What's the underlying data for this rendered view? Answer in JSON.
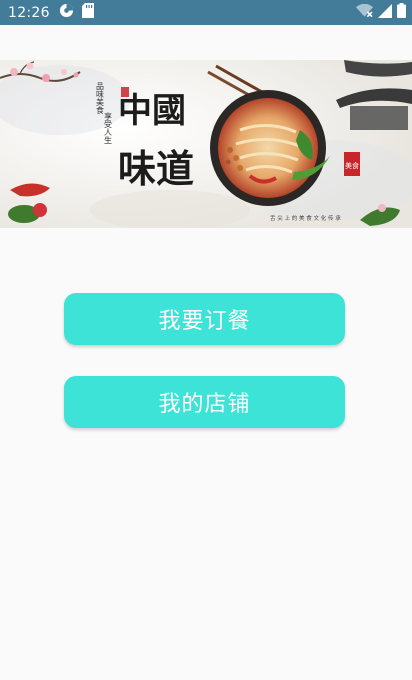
{
  "status_bar": {
    "time": "12:26",
    "icons": [
      "pie-icon",
      "sd-card-icon",
      "wifi-off-icon",
      "signal-icon",
      "battery-icon"
    ]
  },
  "banner": {
    "title_line1": "中國",
    "title_line2": "味道",
    "slogan_left": "品味美食",
    "slogan_right": "享受人生",
    "seal_text": "美食",
    "footer_text": "舌 尖 上 的 美 食 文 化 传 承"
  },
  "actions": {
    "order_label": "我要订餐",
    "shop_label": "我的店铺"
  },
  "colors": {
    "status_bar": "#427c98",
    "button": "#3de3d6",
    "background": "#fafafa"
  }
}
